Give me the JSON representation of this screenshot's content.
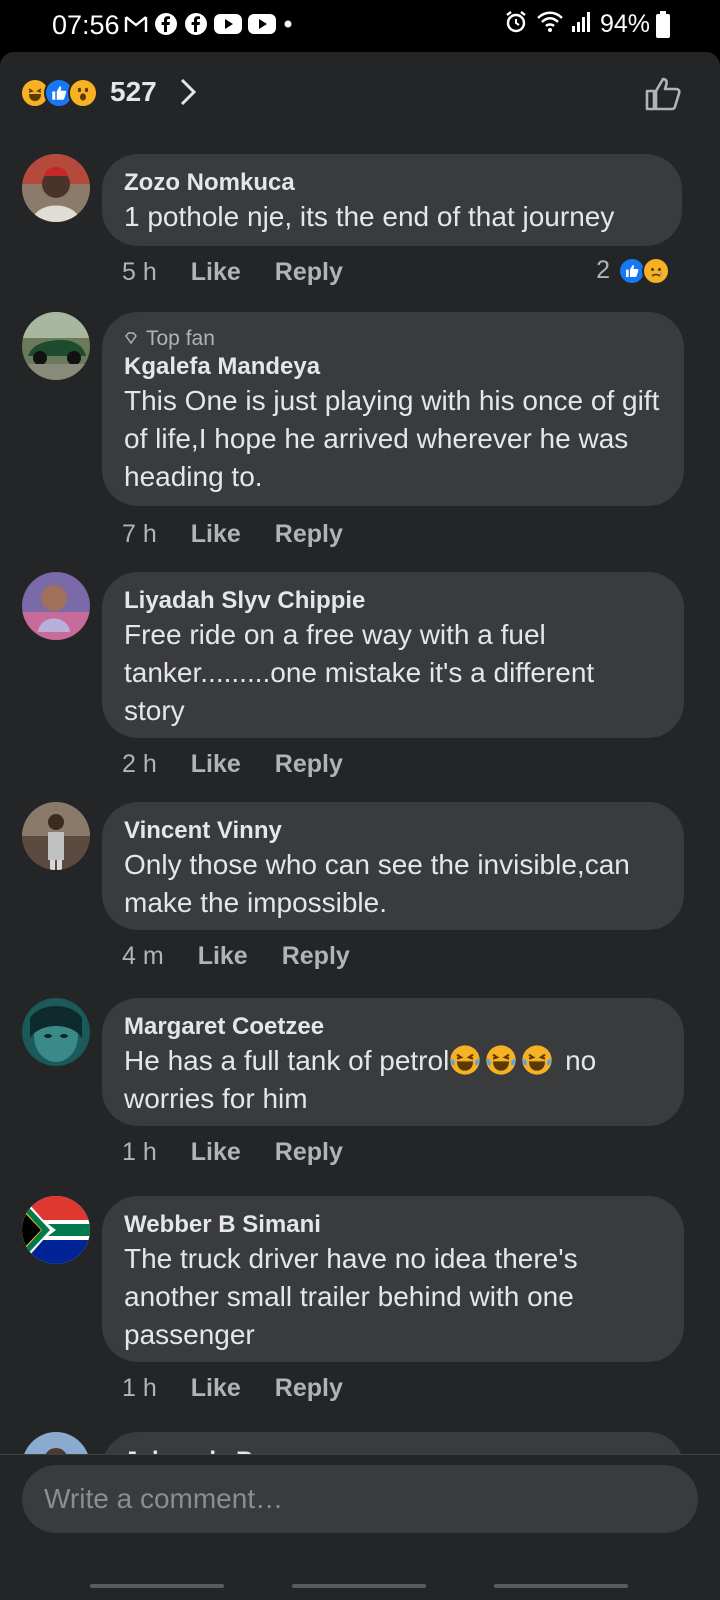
{
  "status_bar": {
    "time": "07:56",
    "battery": "94%",
    "icons": [
      "gmail-icon",
      "facebook-icon",
      "facebook-icon",
      "youtube-icon",
      "youtube-icon",
      "dot-icon"
    ],
    "right_icons": [
      "alarm-icon",
      "wifi-icon",
      "signal-icon"
    ]
  },
  "reactions_header": {
    "count": "527",
    "reactions": [
      "haha",
      "like",
      "wow"
    ]
  },
  "comments": [
    {
      "author": "Zozo Nomkuca",
      "badge": "",
      "text": "1 pothole nje, its the end of that journey",
      "time": "5 h",
      "like": "Like",
      "reply": "Reply",
      "reaction_count": "2",
      "reactions": [
        "like",
        "sad"
      ]
    },
    {
      "author": "Kgalefa Mandeya",
      "badge": "Top fan",
      "text": "This One is just playing with his once of gift of life,I hope he arrived wherever he was heading to.",
      "time": "7 h",
      "like": "Like",
      "reply": "Reply"
    },
    {
      "author": "Liyadah Slyv Chippie",
      "badge": "",
      "text": "Free ride on a free way with a fuel tanker.........one mistake it's a different story",
      "time": "2 h",
      "like": "Like",
      "reply": "Reply"
    },
    {
      "author": "Vincent Vinny",
      "badge": "",
      "text": "Only those who can see the invisible,can make the impossible.",
      "time": "4 m",
      "like": "Like",
      "reply": "Reply"
    },
    {
      "author": "Margaret Coetzee",
      "badge": "",
      "text_before": "He has a full tank of petrol",
      "text_after": " no worries for him",
      "emoji": "face-with-tears-of-joy",
      "time": "1 h",
      "like": "Like",
      "reply": "Reply"
    },
    {
      "author": "Webber B Simani",
      "badge": "",
      "text": "The truck driver have no idea there's another small trailer behind with one passenger",
      "time": "1 h",
      "like": "Like",
      "reply": "Reply"
    },
    {
      "author": "Johan de Bruyn",
      "badge": ""
    }
  ],
  "composer": {
    "placeholder": "Write a comment…"
  },
  "colors": {
    "background": "#242526",
    "bubble": "#3a3b3c",
    "text": "#e4e6eb",
    "secondary": "#b0b3b8",
    "like_blue": "#1877f2",
    "haha_yellow": "#f7b125"
  }
}
